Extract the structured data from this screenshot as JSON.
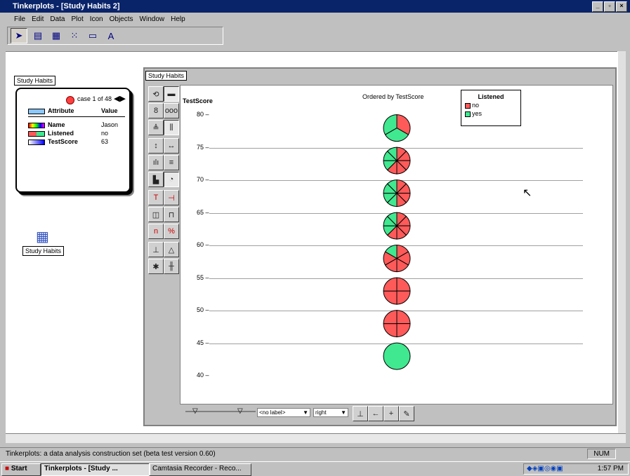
{
  "window": {
    "title": "Tinkerplots - [Study Habits 2]"
  },
  "menu": [
    "File",
    "Edit",
    "Data",
    "Plot",
    "Icon",
    "Objects",
    "Window",
    "Help"
  ],
  "card": {
    "tab": "Study Habits",
    "case_label": "case 1 of 48",
    "col_attr": "Attribute",
    "col_val": "Value",
    "rows": [
      {
        "name": "Name",
        "value": "Jason"
      },
      {
        "name": "Listened",
        "value": "no"
      },
      {
        "name": "TestScore",
        "value": "63"
      }
    ]
  },
  "table_icon_label": "Study Habits",
  "plot": {
    "tab": "Study Habits",
    "title": "Ordered by TestScore",
    "y_attr": "TestScore",
    "ticks": [
      "80",
      "75",
      "70",
      "65",
      "60",
      "55",
      "50",
      "45",
      "40"
    ],
    "legend_title": "Listened",
    "legend_items": [
      {
        "label": "no",
        "color": "#ff5a5a"
      },
      {
        "label": "yes",
        "color": "#40e890"
      }
    ],
    "label_select": "<no label>",
    "align_select": "right"
  },
  "chart_data": {
    "type": "pie",
    "title": "Ordered by TestScore",
    "ylabel": "TestScore",
    "ylim": [
      38,
      82
    ],
    "bins": [
      {
        "center": 78,
        "no": 1,
        "yes": 2
      },
      {
        "center": 73,
        "no": 5,
        "yes": 3
      },
      {
        "center": 68,
        "no": 4,
        "yes": 4
      },
      {
        "center": 63,
        "no": 5,
        "yes": 3
      },
      {
        "center": 58,
        "no": 5,
        "yes": 1
      },
      {
        "center": 53,
        "no": 4,
        "yes": 0
      },
      {
        "center": 48,
        "no": 4,
        "yes": 0
      },
      {
        "center": 43,
        "no": 0,
        "yes": 1
      }
    ]
  },
  "colors": {
    "no": "#ff5a5a",
    "yes": "#40e890",
    "title_bg": "#0a246a"
  },
  "status": {
    "text": "Tinkerplots: a data analysis construction set (beta test version 0.60)",
    "num": "NUM"
  },
  "taskbar": {
    "start": "Start",
    "items": [
      "Tinkerplots - [Study ...",
      "Camtasia Recorder - Reco..."
    ],
    "time": "1:57 PM"
  }
}
